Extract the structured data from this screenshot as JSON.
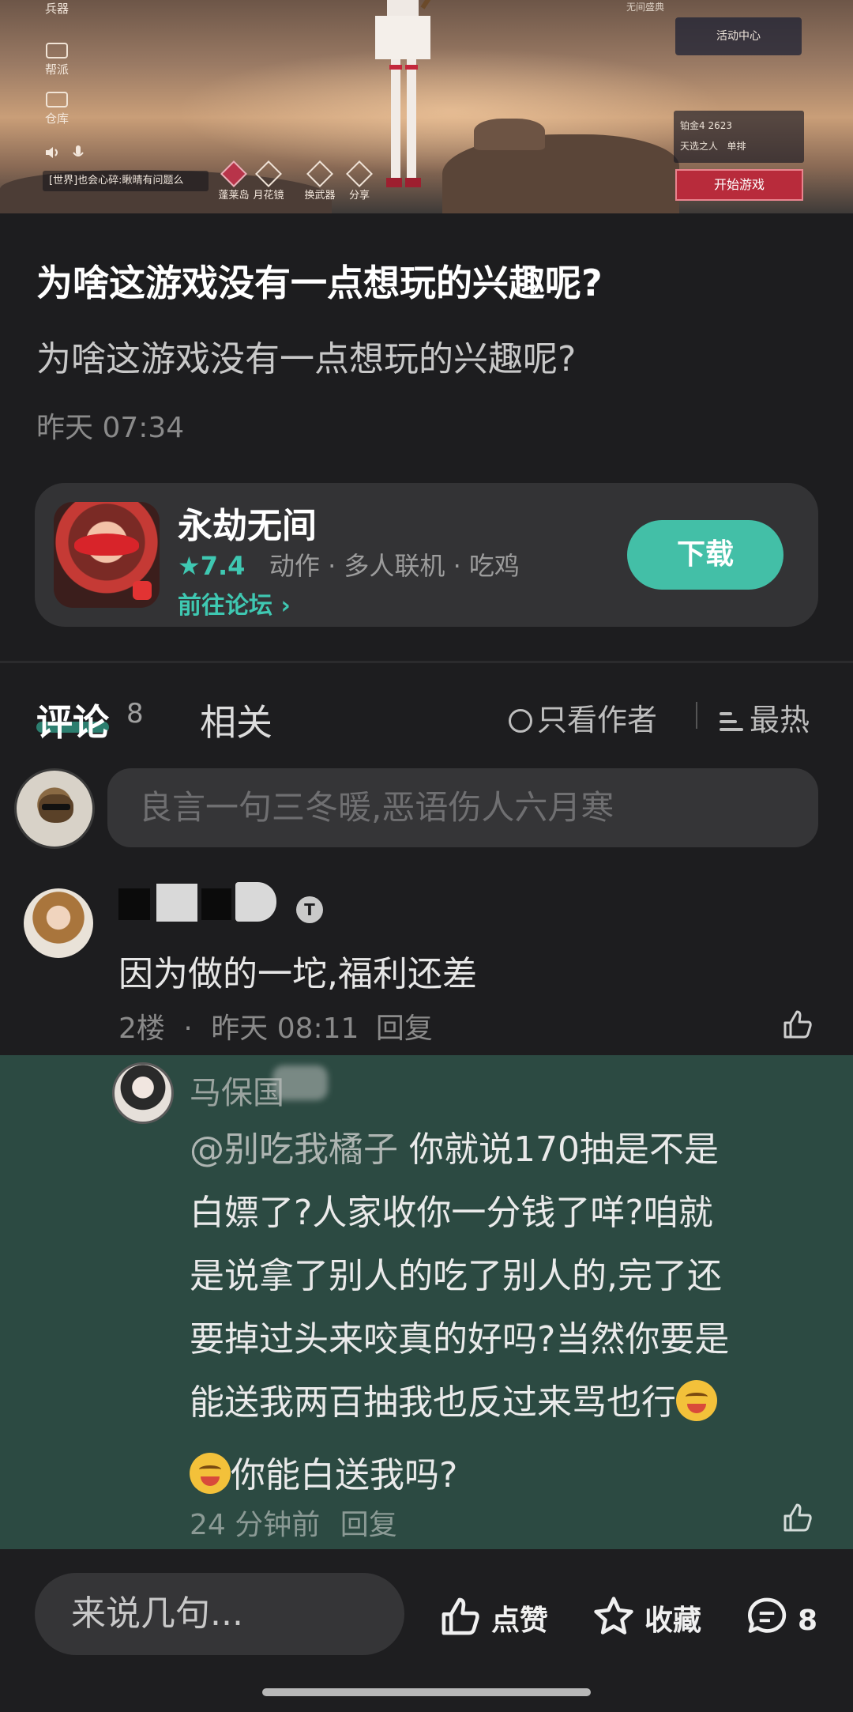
{
  "banner": {
    "left_icons": [
      "兵器",
      "帮派",
      "仓库"
    ],
    "chat": "[世界]也会心碎:瞅晴有问题么",
    "mid_icons": [
      "蓬莱岛",
      "月花镜",
      "换武器",
      "分享"
    ],
    "event_title": "无间盛典",
    "event_label": "活动中心",
    "rank": "铂金4  2623",
    "mode": "天选之人",
    "mode_type": "单排",
    "start_label": "开始游戏"
  },
  "post": {
    "title": "为啥这游戏没有一点想玩的兴趣呢?",
    "body": "为啥这游戏没有一点想玩的兴趣呢?",
    "time": "昨天 07:34"
  },
  "game_card": {
    "name": "永劫无间",
    "rating": "★7.4",
    "tags": "动作 · 多人联机 · 吃鸡",
    "forum_link": "前往论坛 ›",
    "download_label": "下载"
  },
  "tabs": {
    "comments_label": "评论",
    "comments_count": "8",
    "related_label": "相关",
    "only_author_label": "只看作者",
    "sort_label": "最热"
  },
  "compose": {
    "placeholder": "良言一句三冬暖,恶语伤人六月寒"
  },
  "comment1": {
    "badge": "T",
    "text": "因为做的一坨,福利还差",
    "floor": "2楼",
    "dot": "·",
    "time": "昨天 08:11",
    "reply_label": "回复"
  },
  "reply": {
    "name": "马保国",
    "mention": "@别吃我橘子",
    "line1_rest": "  你就说170抽是不是",
    "line2": "白嫖了?人家收你一分钱了咩?咱就",
    "line3": "是说拿了别人的吃了别人的,完了还",
    "line4": "要掉过头来咬真的好吗?当然你要是",
    "line5": "能送我两百抽我也反过来骂也行",
    "line6": "你能白送我吗?",
    "time": "24 分钟前",
    "reply_label": "回复"
  },
  "bottom_bar": {
    "input_placeholder": "来说几句...",
    "like_label": "点赞",
    "fav_label": "收藏",
    "comment_count": "8"
  },
  "colors": {
    "accent": "#43bfa7",
    "background": "#1d1d1f",
    "reply_highlight": "#2c4a42",
    "card": "#333335"
  }
}
